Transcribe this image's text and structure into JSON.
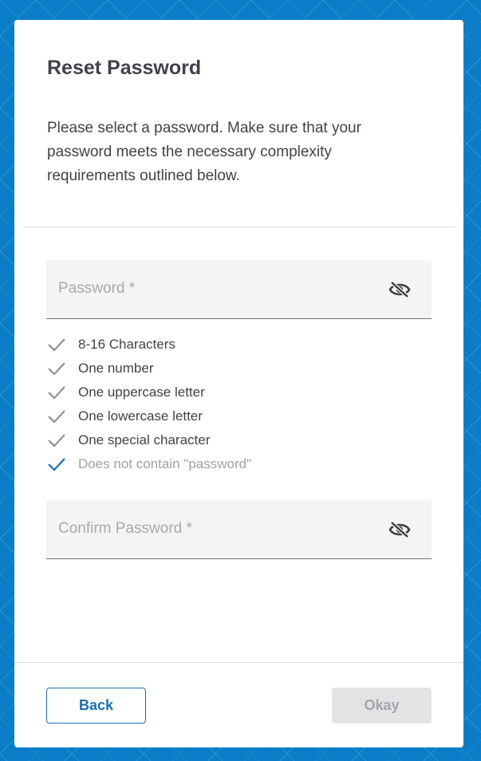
{
  "dialog": {
    "title": "Reset Password",
    "description": "Please select a password. Make sure that your password meets the necessary complexity requirements outlined below."
  },
  "password_field": {
    "placeholder": "Password *",
    "value": "",
    "toggle_icon": "eye-slash-icon"
  },
  "requirements": [
    {
      "label": "8-16 Characters",
      "met": false
    },
    {
      "label": "One number",
      "met": false
    },
    {
      "label": "One uppercase letter",
      "met": false
    },
    {
      "label": "One lowercase letter",
      "met": false
    },
    {
      "label": "One special character",
      "met": false
    },
    {
      "label": "Does not contain \"password\"",
      "met": true
    }
  ],
  "confirm_field": {
    "placeholder": "Confirm Password *",
    "value": "",
    "toggle_icon": "eye-slash-icon"
  },
  "buttons": {
    "back_label": "Back",
    "okay_label": "Okay",
    "okay_disabled": true
  },
  "colors": {
    "background": "#0b7dc8",
    "accent": "#1a6faf",
    "check_unmet": "#8e9397",
    "check_met": "#1a6faf"
  }
}
